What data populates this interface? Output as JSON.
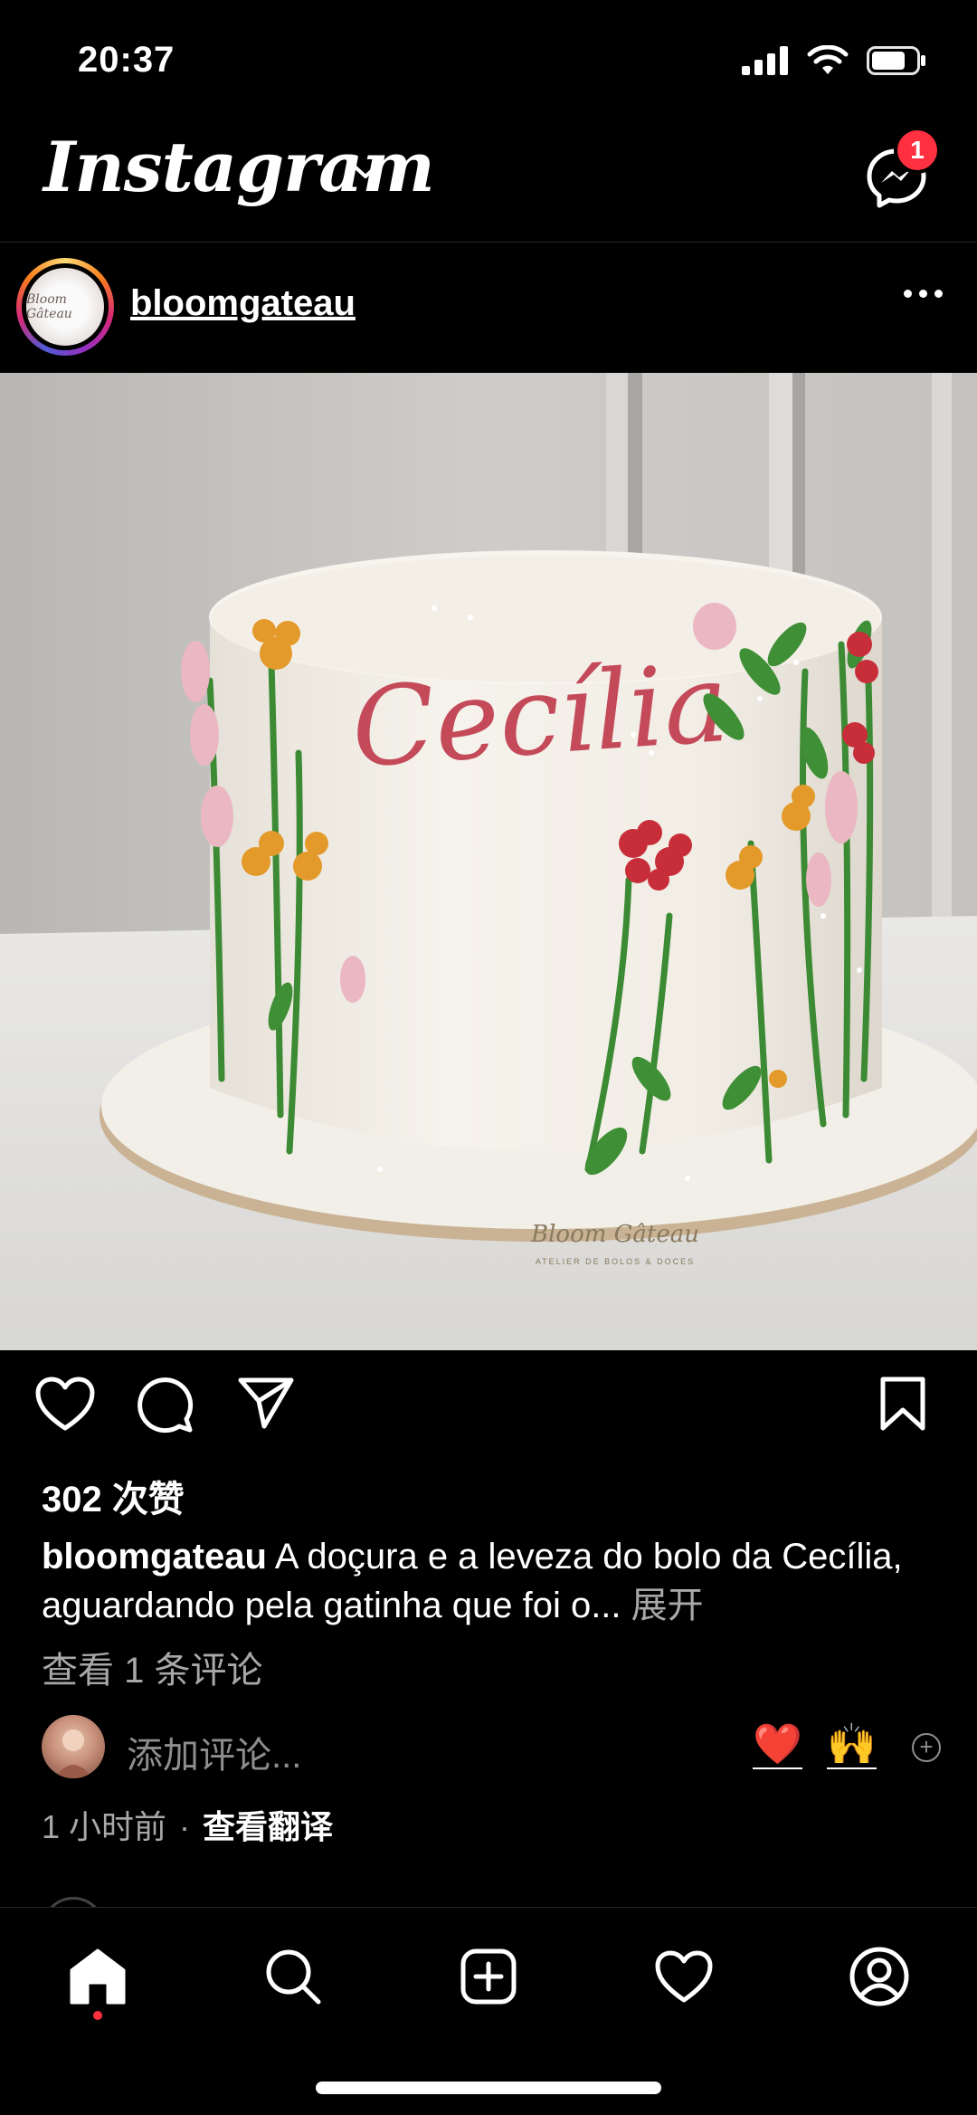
{
  "status": {
    "time": "20:37"
  },
  "header": {
    "logo": "Instagram",
    "messenger_badge": "1"
  },
  "post": {
    "username": "bloomgateau",
    "image_text": {
      "cake_name": "Cecília",
      "board_brand": "Bloom Gâteau",
      "board_sub": "ATELIER DE BOLOS & DOCES",
      "avatar_brand": "Bloom Gâteau"
    },
    "likes": "302 次赞",
    "caption_username": "bloomgateau",
    "caption_text": "A doçura e a leveza do bolo da Cecília, aguardando pela gatinha que foi o...",
    "caption_more": "展开",
    "view_comments": "查看 1 条评论",
    "add_comment_placeholder": "添加评论...",
    "quick_emojis": [
      "❤️",
      "🙌"
    ],
    "time_ago": "1 小时前",
    "meta_separator": "·",
    "translate": "查看翻译"
  },
  "colors": {
    "background": "#000000",
    "secondary_text": "#a8a8a8",
    "badge": "#ff3040"
  },
  "icons": [
    "signal-icon",
    "wifi-icon",
    "battery-icon",
    "chevron-down-icon",
    "messenger-icon",
    "more-icon",
    "heart-icon",
    "comment-icon",
    "share-icon",
    "bookmark-icon",
    "home-icon",
    "search-icon",
    "create-icon",
    "activity-icon",
    "profile-icon"
  ]
}
